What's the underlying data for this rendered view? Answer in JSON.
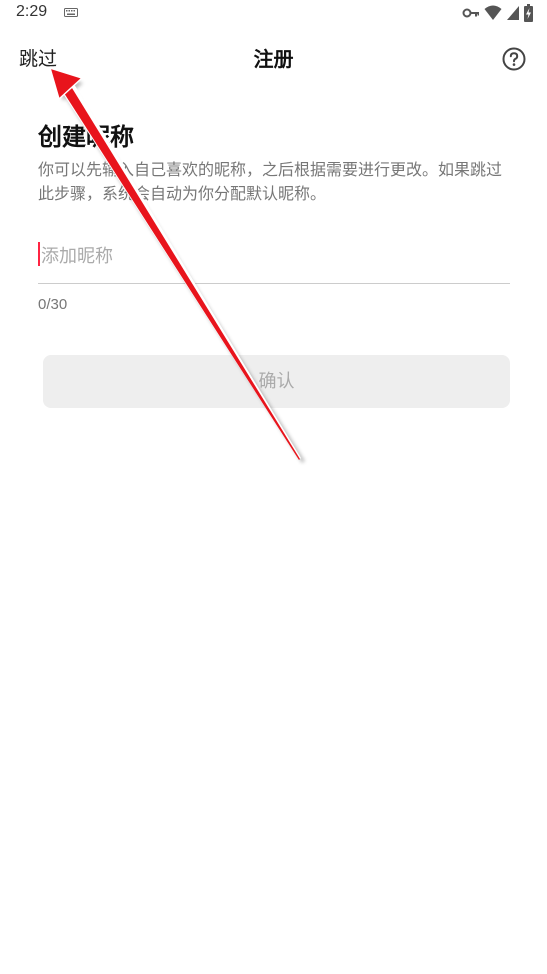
{
  "status_bar": {
    "time": "2:29",
    "icons": [
      "keyboard-icon",
      "vpn-key-icon",
      "wifi-icon",
      "signal-icon",
      "battery-charging-icon"
    ]
  },
  "header": {
    "skip_label": "跳过",
    "title": "注册",
    "help_icon": "help-circle-icon"
  },
  "content": {
    "heading": "创建昵称",
    "description": "你可以先输入自己喜欢的昵称，之后根据需要进行更改。如果跳过此步骤，系统会自动为你分配默认昵称。"
  },
  "nickname_field": {
    "value": "",
    "placeholder": "添加昵称",
    "counter": "0/30"
  },
  "confirm_button": {
    "label": "确认",
    "enabled": false
  },
  "colors": {
    "accent": "#ff2442",
    "annotation_arrow": "#e8141c",
    "button_disabled_bg": "#eeeeee"
  }
}
